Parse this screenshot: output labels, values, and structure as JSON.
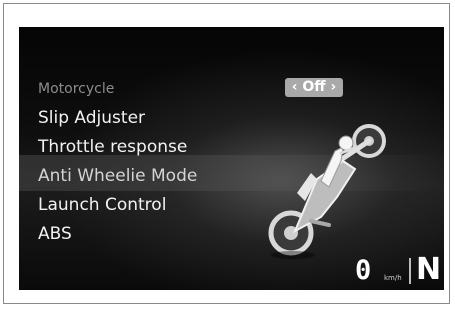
{
  "menu": {
    "items": [
      {
        "label": "Motorcycle"
      },
      {
        "label": "Slip Adjuster"
      },
      {
        "label": "Throttle response"
      },
      {
        "label": "Anti Wheelie Mode"
      },
      {
        "label": "Launch Control"
      },
      {
        "label": "ABS"
      }
    ],
    "selected_value": "‹ Off ›"
  },
  "status": {
    "speed": "0",
    "speed_unit": "km/h",
    "gear": "N"
  },
  "icons": {
    "wheelie": "motorcycle-wheelie-icon"
  },
  "colors": {
    "screen_bg": "#0a0a0a",
    "value_pill": "#a9a9a9",
    "text": "#f2f2f2",
    "dim_text": "#8c8c8c"
  }
}
